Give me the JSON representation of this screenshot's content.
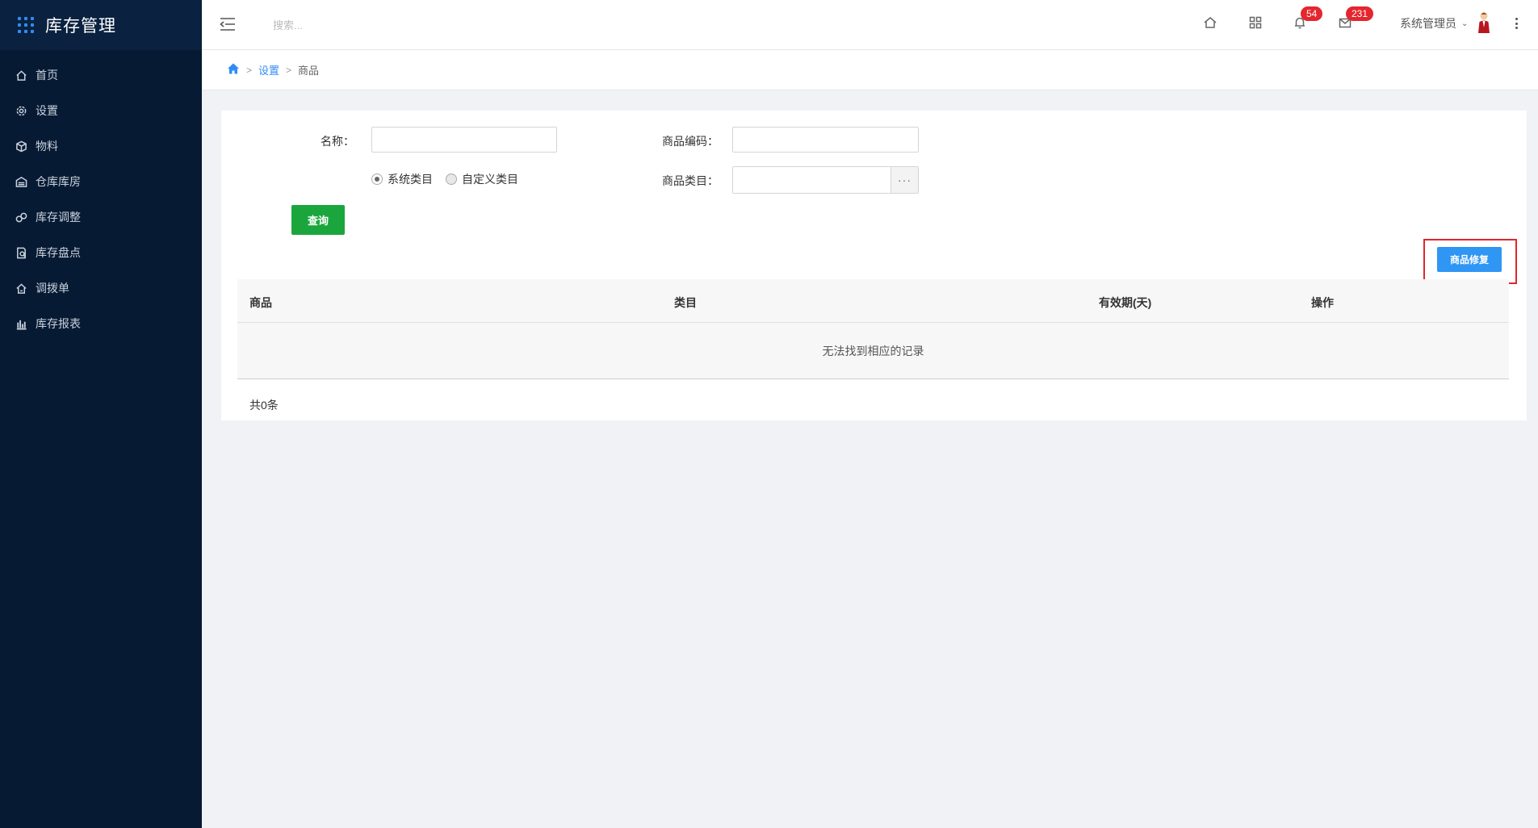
{
  "app": {
    "title": "库存管理"
  },
  "sidebar": {
    "items": [
      {
        "label": "首页",
        "icon": "home-icon"
      },
      {
        "label": "设置",
        "icon": "gear-icon"
      },
      {
        "label": "物料",
        "icon": "cube-icon"
      },
      {
        "label": "仓库库房",
        "icon": "warehouse-icon"
      },
      {
        "label": "库存调整",
        "icon": "adjust-icon"
      },
      {
        "label": "库存盘点",
        "icon": "inventory-check-icon"
      },
      {
        "label": "调拨单",
        "icon": "transfer-icon"
      },
      {
        "label": "库存报表",
        "icon": "bar-chart-icon"
      }
    ]
  },
  "header": {
    "search_placeholder": "搜索...",
    "notifications_count": "54",
    "messages_count": "231",
    "user_name": "系统管理员"
  },
  "breadcrumb": {
    "level1": "设置",
    "level2": "商品"
  },
  "form": {
    "name_label": "名称：",
    "name_value": "",
    "code_label": "商品编码：",
    "code_value": "",
    "radio_system": "系统类目",
    "radio_custom": "自定义类目",
    "radio_selected": "系统类目",
    "category_label": "商品类目：",
    "category_value": "",
    "category_button": "···",
    "query_button": "查询"
  },
  "actions": {
    "fix_button": "商品修复"
  },
  "table": {
    "columns": [
      "商品",
      "类目",
      "有效期(天)",
      "操作"
    ],
    "empty_text": "无法找到相应的记录",
    "total_text": "共0条"
  },
  "colors": {
    "sidebar_bg": "#071a33",
    "accent_blue": "#2f8cf5",
    "query_green": "#1aa63d",
    "badge_red": "#e5262e",
    "highlight_red": "#e0262e"
  }
}
